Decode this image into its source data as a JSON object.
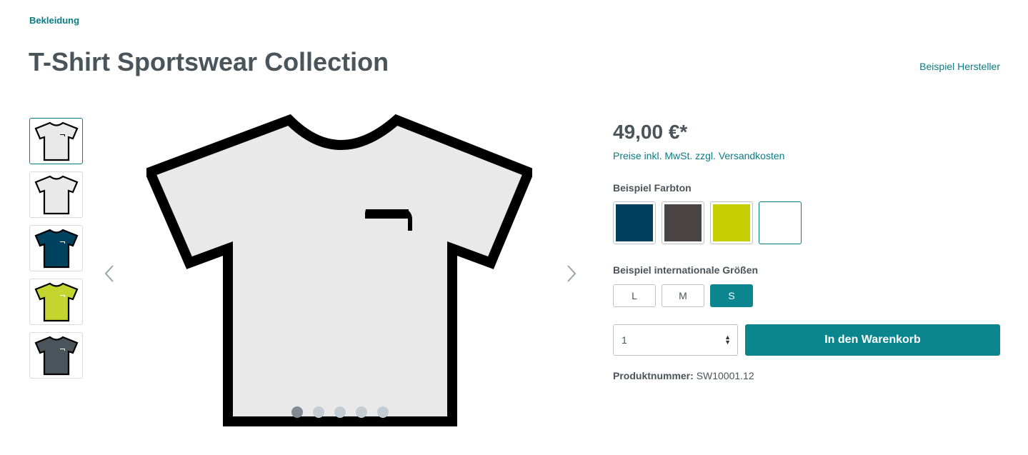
{
  "breadcrumb": "Bekleidung",
  "product": {
    "title": "T-Shirt Sportswear Collection",
    "manufacturer": "Beispiel Hersteller",
    "price": "49,00 €*",
    "tax_note": "Preise inkl. MwSt. zzgl. Versandkosten",
    "product_number_label": "Produktnummer:",
    "product_number": "SW10001.12"
  },
  "thumbnails": [
    {
      "color": "#e9e9e9",
      "logo": "#000000"
    },
    {
      "color": "#e9e9e9",
      "logo": "none"
    },
    {
      "color": "#004260",
      "logo": "#ffffff"
    },
    {
      "color": "#c3d52e",
      "logo": "#ffffff"
    },
    {
      "color": "#4a545b",
      "logo": "#ffffff"
    }
  ],
  "gallery": {
    "slide_count": 5,
    "active_slide": 1,
    "shirt_color": "#e9e9e9"
  },
  "options": {
    "color_label": "Beispiel Farbton",
    "colors": [
      "#003f5e",
      "#4a4445",
      "#c8cf00",
      "#ffffff"
    ],
    "selected_color": 3,
    "size_label": "Beispiel internationale Größen",
    "sizes": [
      "L",
      "M",
      "S"
    ],
    "selected_size": "S"
  },
  "cart": {
    "quantity": "1",
    "button_label": "In den Warenkorb"
  },
  "colors": {
    "accent": "#0b868f",
    "link": "#0b7c85",
    "text": "#4a545b"
  }
}
